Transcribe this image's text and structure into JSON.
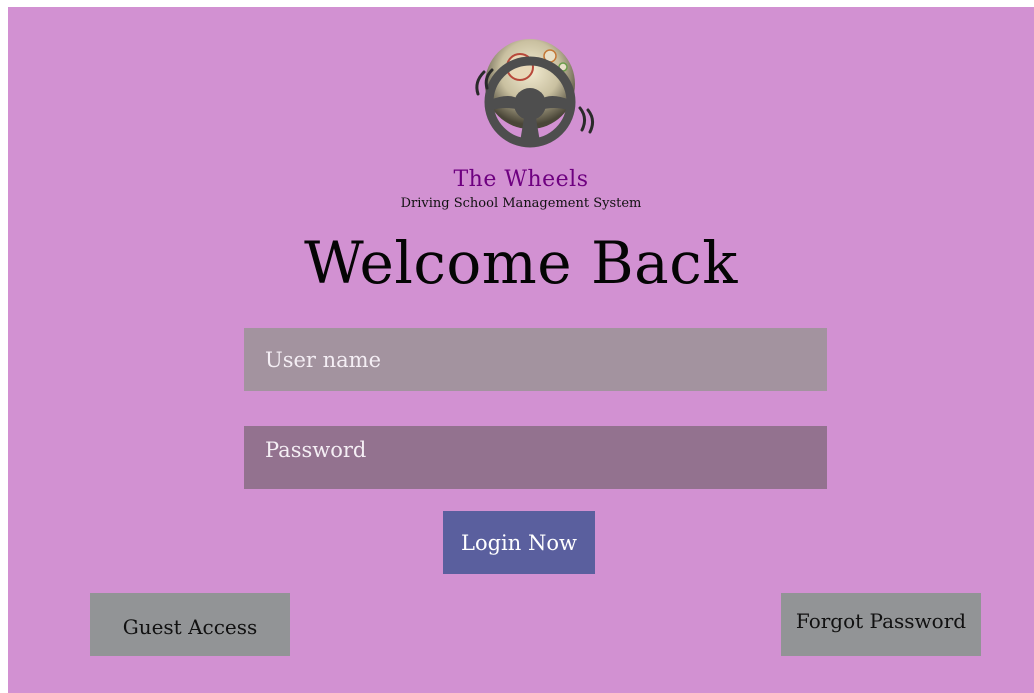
{
  "brand": {
    "name": "The Wheels",
    "subtitle": "Driving School Management System",
    "logo_icon": "steering-wheel-icon"
  },
  "heading": "Welcome Back",
  "form": {
    "username_placeholder": "User name",
    "username_value": "",
    "password_placeholder": "Password",
    "password_value": ""
  },
  "buttons": {
    "login": "Login Now",
    "guest": "Guest Access",
    "forgot": "Forgot Password"
  },
  "colors": {
    "background": "#d291d2",
    "brand_text": "#6e0080",
    "username_field": "#a3939f",
    "password_field": "#93728f",
    "login_button": "#5a5f9e",
    "secondary_button": "#929496"
  }
}
